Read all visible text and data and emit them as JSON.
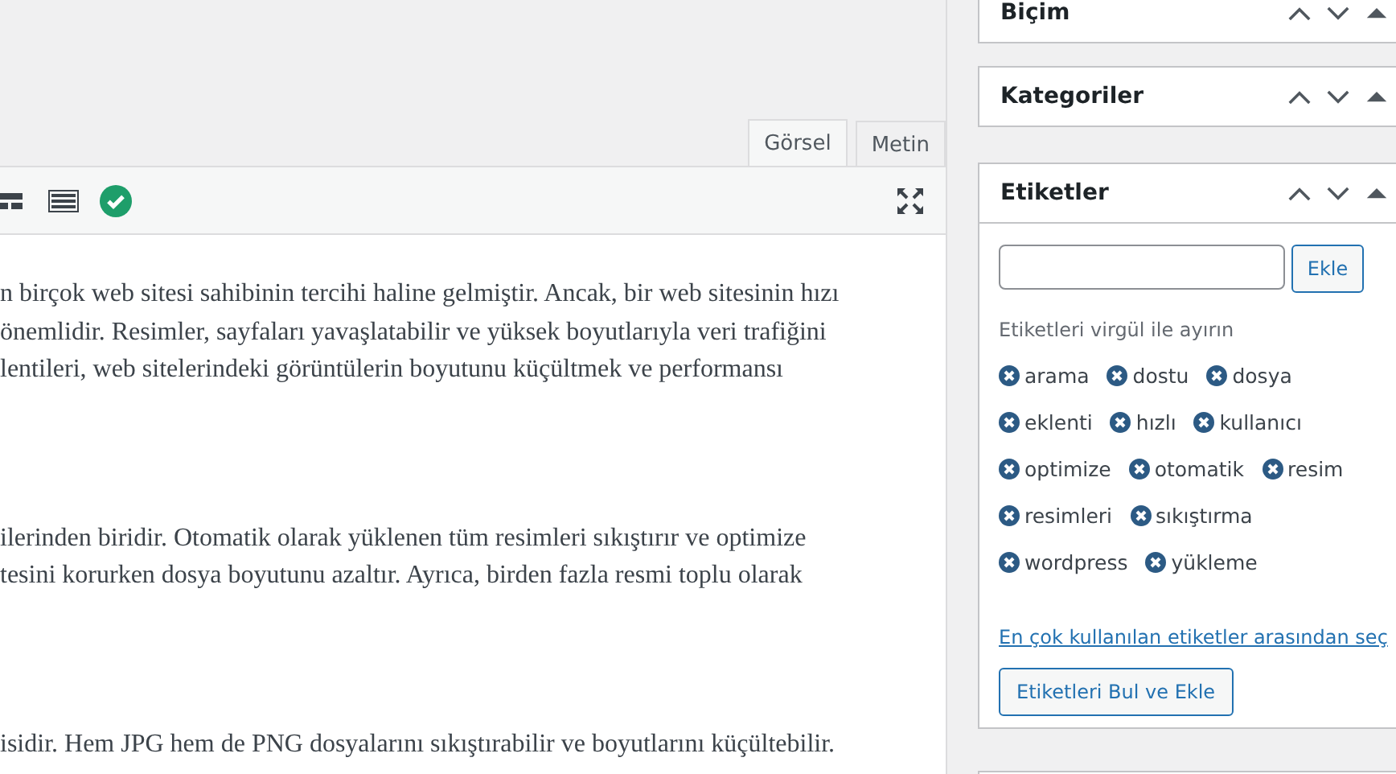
{
  "editor": {
    "tabs": [
      {
        "label": "Görsel",
        "selected": true
      },
      {
        "label": "Metin",
        "selected": false
      }
    ],
    "paragraphs": [
      [
        "n birçok web sitesi sahibinin tercihi haline gelmiştir. Ancak, bir web sitesinin hızı",
        "önemlidir. Resimler, sayfaları yavaşlatabilir ve yüksek boyutlarıyla veri trafiğini",
        "lentileri, web sitelerindeki görüntülerin boyutunu küçültmek ve performansı"
      ],
      [
        "ilerinden biridir. Otomatik olarak yüklenen tüm resimleri sıkıştırır ve optimize",
        "tesini korurken dosya boyutunu azaltır. Ayrıca, birden fazla resmi toplu olarak"
      ],
      [
        "isidir. Hem JPG hem de PNG dosyalarını sıkıştırabilir ve boyutlarını küçültebilir."
      ]
    ]
  },
  "sidebar": {
    "panels": [
      {
        "title": "Biçim"
      },
      {
        "title": "Kategoriler"
      }
    ],
    "tags_panel": {
      "title": "Etiketler",
      "input": {
        "button": "Ekle"
      },
      "hint": "Etiketleri virgül ile ayırın",
      "tags": [
        "arama",
        "dostu",
        "dosya",
        "eklenti",
        "hızlı",
        "kullanıcı",
        "optimize",
        "otomatik",
        "resim",
        "resimleri",
        "sıkıştırma",
        "wordpress",
        "yükleme"
      ],
      "link": "En çok kullanılan etiketler arasından seç",
      "button": "Etiketleri Bul ve Ekle"
    }
  }
}
